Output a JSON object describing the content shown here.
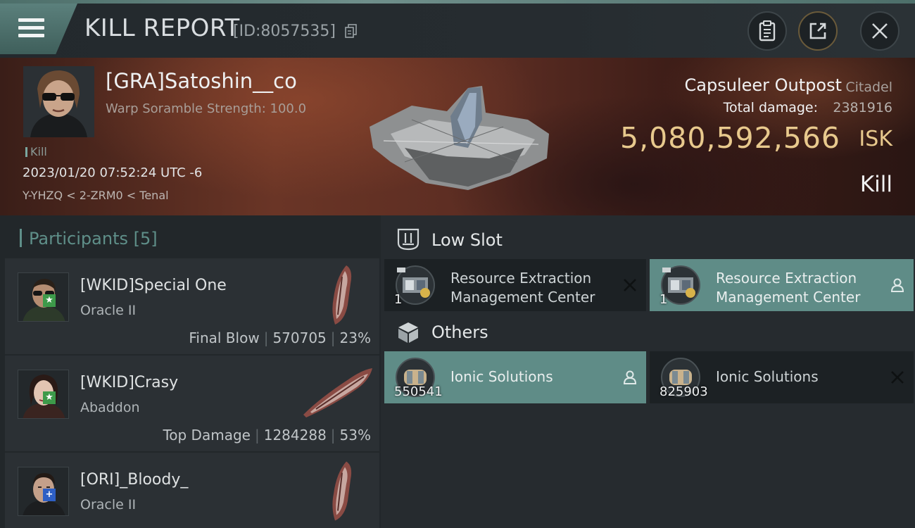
{
  "header": {
    "title": "KILL REPORT",
    "report_id": "[ID:8057535]"
  },
  "victim": {
    "name": "[GRA]Satoshin__co",
    "warp_scramble": "Warp Soramble Strength: 100.0",
    "kill_tag": "Kill",
    "datetime": "2023/01/20 07:52:24 UTC -6",
    "location": "Y-YHZQ < 2-ZRM0 < Tenal"
  },
  "target": {
    "name": "Capsuleer Outpost",
    "class": "Citadel",
    "damage_label": "Total damage:",
    "damage_value": "2381916",
    "isk_value": "5,080,592,566",
    "isk_unit": "ISK",
    "result": "Kill"
  },
  "participants": {
    "label": "Participants [5]",
    "items": [
      {
        "name": "[WKID]Special One",
        "ship": "Oracle II",
        "role": "Final Blow",
        "damage": "570705",
        "percent": "23%",
        "badge": "★"
      },
      {
        "name": "[WKID]Crasy",
        "ship": "Abaddon",
        "role": "Top Damage",
        "damage": "1284288",
        "percent": "53%",
        "badge": "★"
      },
      {
        "name": "[ORI]_Bloody_",
        "ship": "Oracle II",
        "role": "",
        "damage": "",
        "percent": "",
        "badge": "+"
      }
    ]
  },
  "fitting": {
    "low_slot": {
      "label": "Low Slot",
      "modules": [
        {
          "name_line1": "Resource Extraction",
          "name_line2": "Management Center",
          "qty": "1",
          "status": "destroyed"
        },
        {
          "name_line1": "Resource Extraction",
          "name_line2": "Management Center",
          "qty": "1",
          "status": "dropped"
        }
      ]
    },
    "others": {
      "label": "Others",
      "items": [
        {
          "name": "Ionic Solutions",
          "qty": "550541",
          "status": "dropped"
        },
        {
          "name": "Ionic Solutions",
          "qty": "825903",
          "status": "destroyed"
        }
      ]
    }
  },
  "colors": {
    "accent_teal": "#5f8c87",
    "isk_gold": "#e8c98d",
    "star_badge": "#3d9a4a",
    "plus_badge": "#2e5fc4"
  }
}
